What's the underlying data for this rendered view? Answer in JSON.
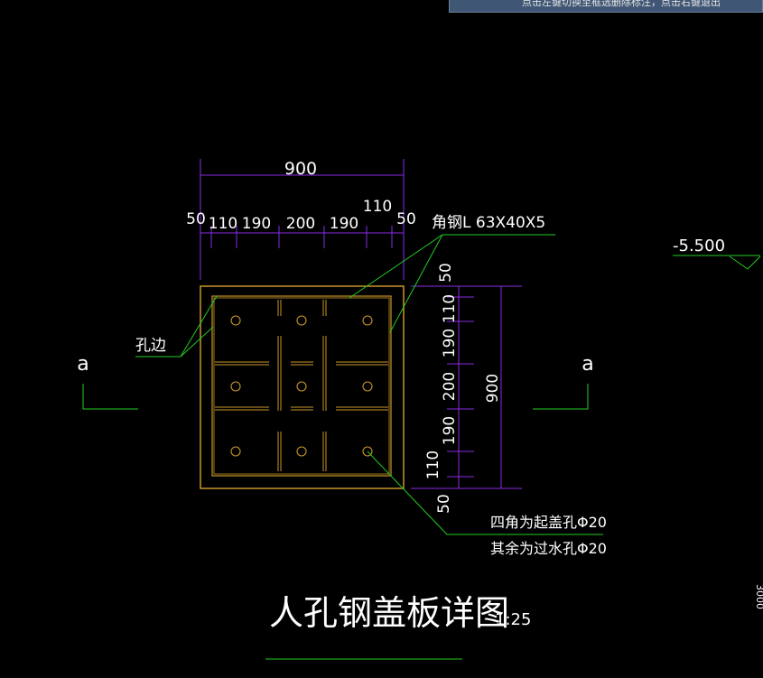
{
  "command_tip": "点击左键切换至框选删除标注，点击右键退出",
  "drawing": {
    "title": "人孔钢盖板详图",
    "scale": "1:25",
    "elevation": "-5.500",
    "section_left": "a",
    "section_right": "a",
    "top_total": "900",
    "top_dims": [
      "50",
      "110",
      "190",
      "200",
      "190",
      "110",
      "50"
    ],
    "right_total": "900",
    "right_dims": [
      "50",
      "110",
      "190",
      "200",
      "190",
      "110",
      "50"
    ],
    "label_angle": "角钢L 63X40X5",
    "label_hole_edge": "孔边",
    "note_line1": "四角为起盖孔Φ20",
    "note_line2": "其余为过水孔Φ20",
    "edge_text": "3000"
  },
  "colors": {
    "background": "#000000",
    "dimension": "#8a2be2",
    "plate": "#c8962a",
    "leader": "#22cc22",
    "text": "#ffffff"
  }
}
